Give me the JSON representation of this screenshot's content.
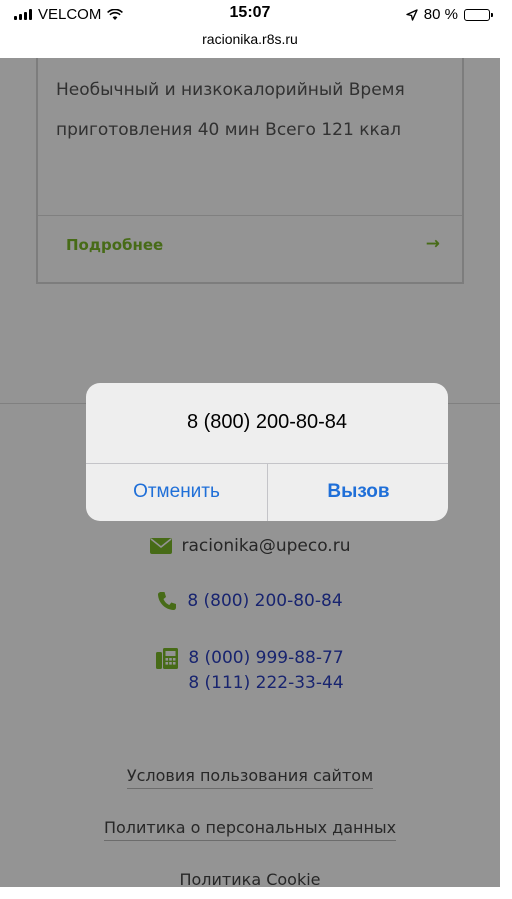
{
  "status_bar": {
    "carrier": "VELCOM",
    "time": "15:07",
    "url": "racionika.r8s.ru",
    "battery": "80 %",
    "battery_level_fraction": 0.8
  },
  "card": {
    "description": "Необычный и низкокалорийный Время приготовления 40 мин Всего 121 ккал",
    "more_label": "Подробнее",
    "arrow": "→"
  },
  "contacts": {
    "email": "racionika@upeco.ru",
    "phone": "8 (800) 200-80-84",
    "fax_1": "8 (000) 999-88-77",
    "fax_2": "8 (111) 222-33-44"
  },
  "footer": {
    "terms": "Условия пользования сайтом",
    "privacy": "Политика о персональных данных",
    "cookie": "Политика Cookie"
  },
  "dialog": {
    "title": "8 (800) 200-80-84",
    "cancel_label": "Отменить",
    "call_label": "Вызов"
  },
  "colors": {
    "accent_green": "#7ab929",
    "link_blue": "#2a3fc0",
    "ios_blue": "#1f6fd8"
  }
}
